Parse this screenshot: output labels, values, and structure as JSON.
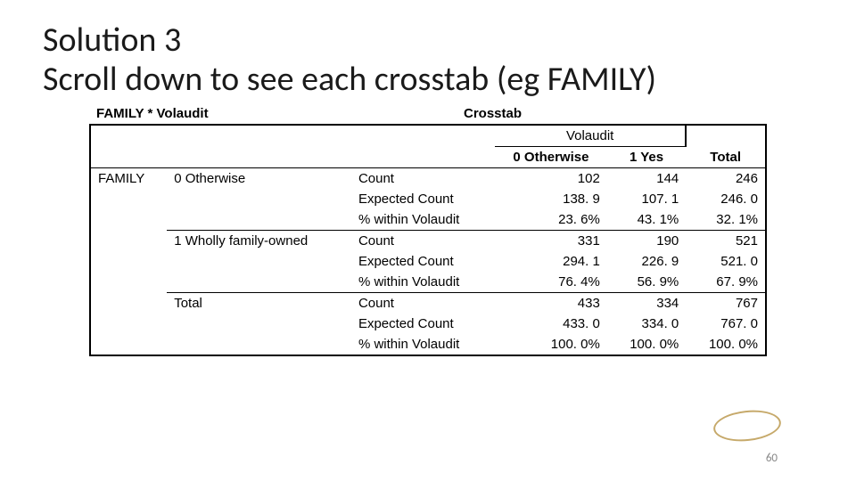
{
  "title_line1": "Solution 3",
  "title_line2": "Scroll down to see each crosstab (eg FAMILY)",
  "table_title_left": "FAMILY * Volaudit",
  "table_title_right": "Crosstab",
  "spanner": "Volaudit",
  "col_headers": {
    "c1": "0 Otherwise",
    "c2": "1 Yes",
    "c3": "Total"
  },
  "row_var": "FAMILY",
  "stat_labels": {
    "count": "Count",
    "expected": "Expected Count",
    "pct": "% within Volaudit"
  },
  "groups": [
    {
      "label": "0 Otherwise",
      "count": {
        "c1": "102",
        "c2": "144",
        "c3": "246"
      },
      "expected": {
        "c1": "138. 9",
        "c2": "107. 1",
        "c3": "246. 0"
      },
      "pct": {
        "c1": "23. 6%",
        "c2": "43. 1%",
        "c3": "32. 1%"
      }
    },
    {
      "label": "1 Wholly family-owned",
      "count": {
        "c1": "331",
        "c2": "190",
        "c3": "521"
      },
      "expected": {
        "c1": "294. 1",
        "c2": "226. 9",
        "c3": "521. 0"
      },
      "pct": {
        "c1": "76. 4%",
        "c2": "56. 9%",
        "c3": "67. 9%"
      }
    },
    {
      "label": "Total",
      "count": {
        "c1": "433",
        "c2": "334",
        "c3": "767"
      },
      "expected": {
        "c1": "433. 0",
        "c2": "334. 0",
        "c3": "767. 0"
      },
      "pct": {
        "c1": "100. 0%",
        "c2": "100. 0%",
        "c3": "100. 0%"
      }
    }
  ],
  "page_number": "60",
  "chart_data": {
    "type": "table",
    "row_variable": "FAMILY",
    "col_variable": "Volaudit",
    "columns": [
      "0 Otherwise",
      "1 Yes",
      "Total"
    ],
    "rows": [
      {
        "category": "0 Otherwise",
        "Count": [
          102,
          144,
          246
        ],
        "Expected Count": [
          138.9,
          107.1,
          246.0
        ],
        "% within Volaudit": [
          23.6,
          43.1,
          32.1
        ]
      },
      {
        "category": "1 Wholly family-owned",
        "Count": [
          331,
          190,
          521
        ],
        "Expected Count": [
          294.1,
          226.9,
          521.0
        ],
        "% within Volaudit": [
          76.4,
          56.9,
          67.9
        ]
      },
      {
        "category": "Total",
        "Count": [
          433,
          334,
          767
        ],
        "Expected Count": [
          433.0,
          334.0,
          767.0
        ],
        "% within Volaudit": [
          100.0,
          100.0,
          100.0
        ]
      }
    ],
    "highlight": {
      "row": "Total",
      "stat": "Count",
      "column": "Total",
      "value": 767
    }
  }
}
